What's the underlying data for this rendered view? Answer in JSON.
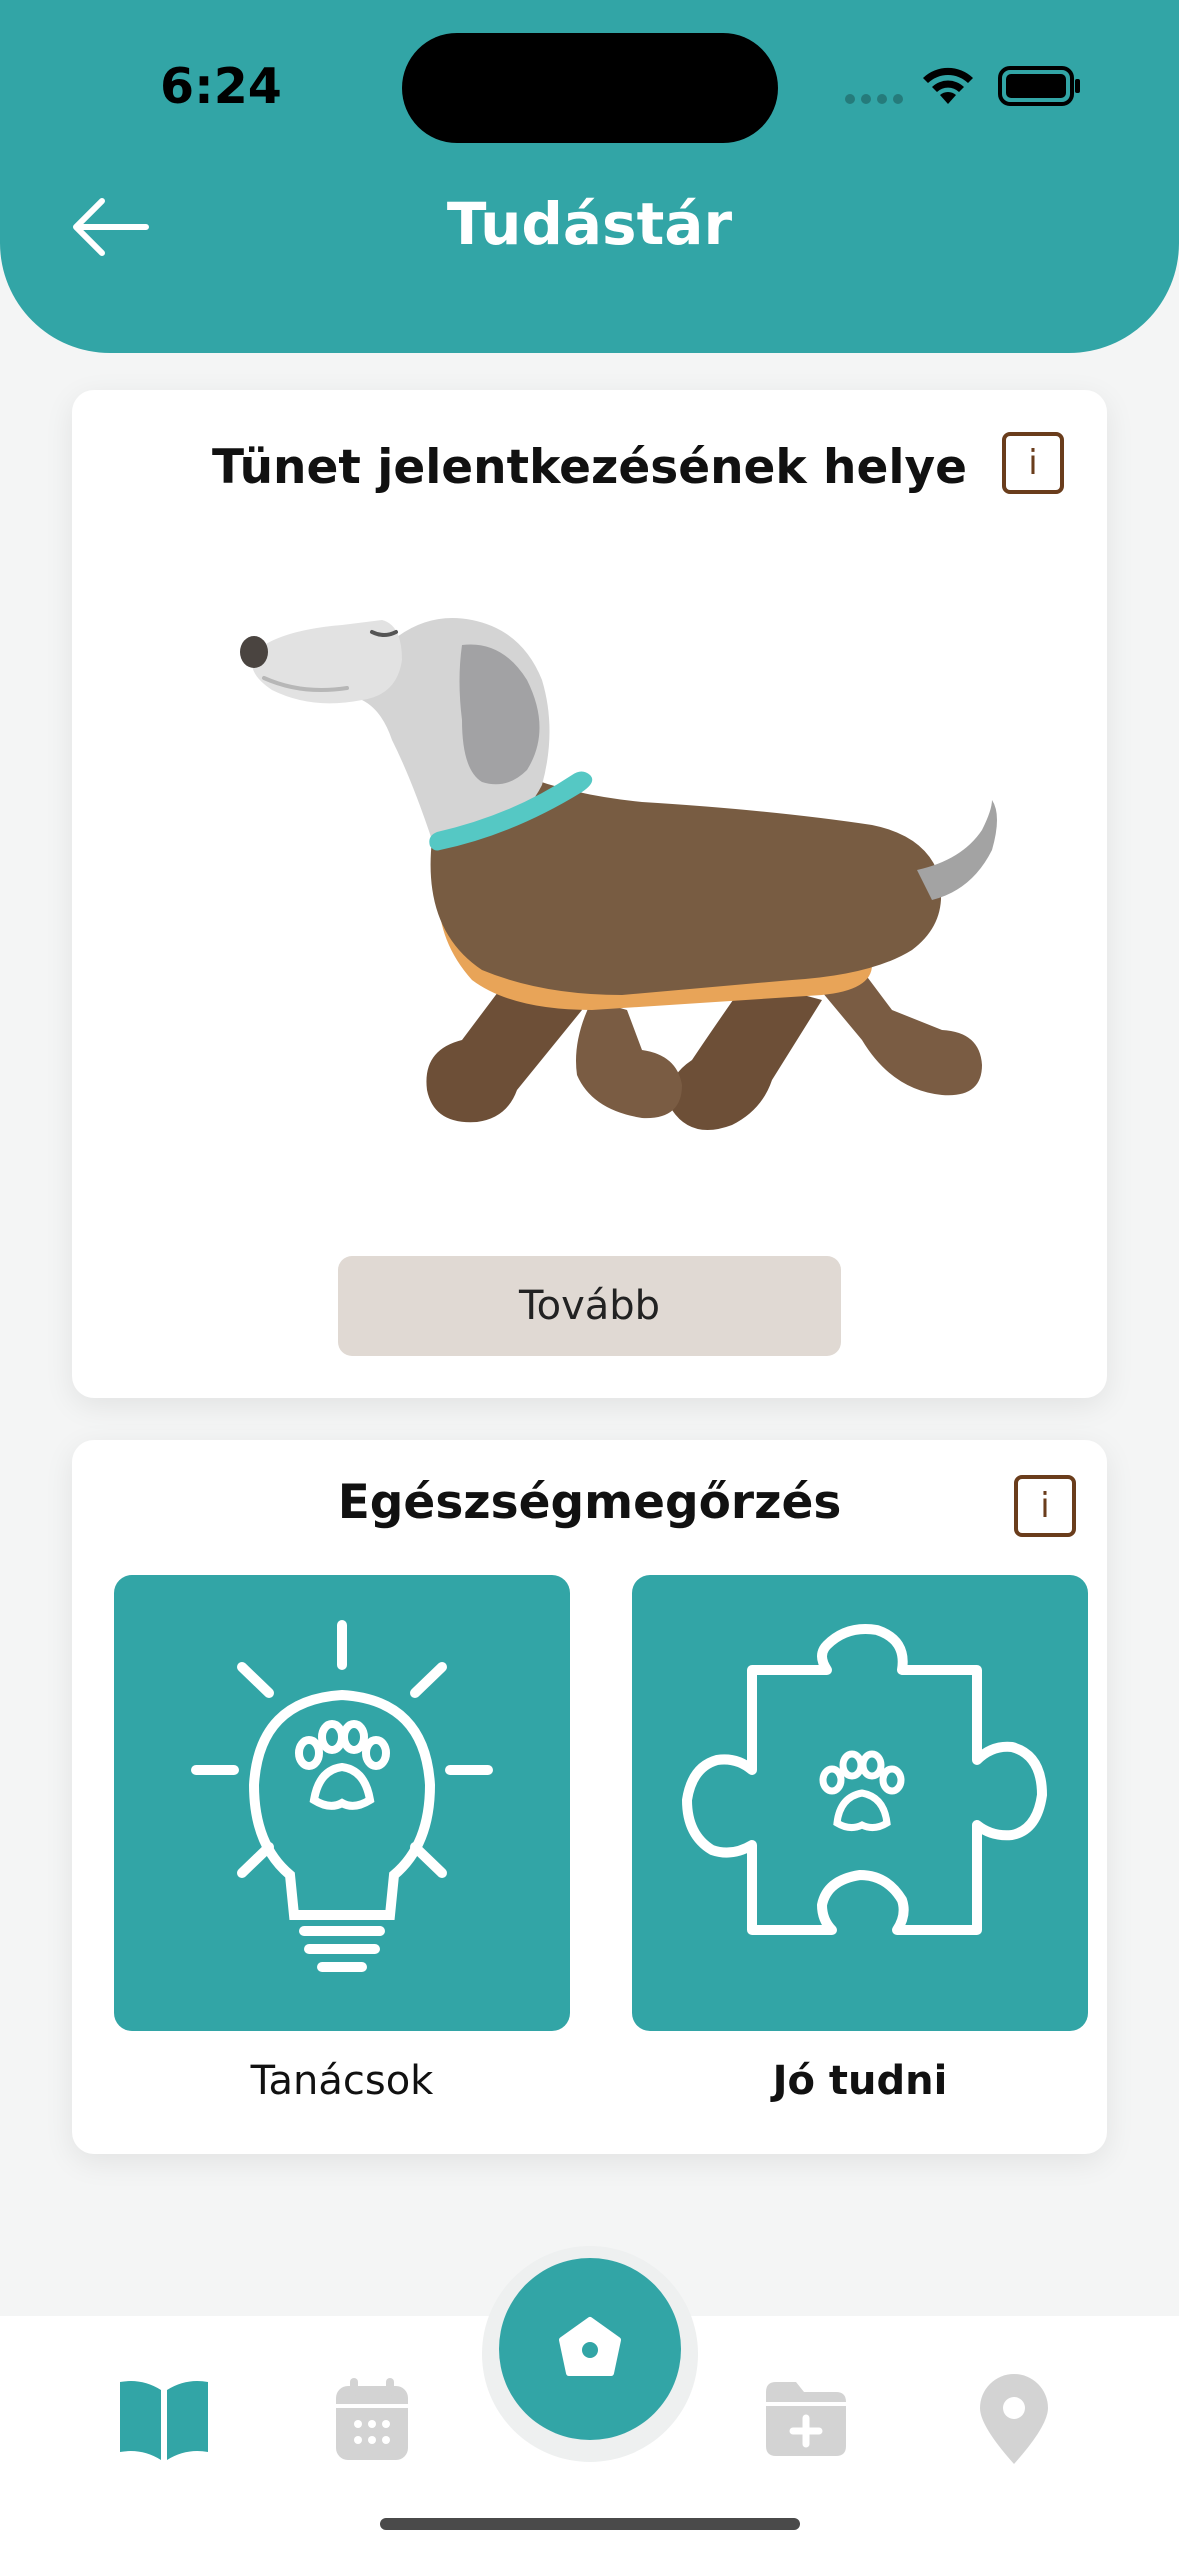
{
  "status_bar": {
    "time": "6:24"
  },
  "header": {
    "title": "Tudástár"
  },
  "symptom_card": {
    "title": "Tünet jelentkezésének helye",
    "info_label": "i",
    "next_label": "Tovább"
  },
  "health_card": {
    "title": "Egészségmegőrzés",
    "info_label": "i",
    "tiles": [
      {
        "label": "Tanácsok",
        "icon": "lightbulb-paw-icon"
      },
      {
        "label": "Jó tudni",
        "icon": "puzzle-paw-icon"
      }
    ]
  },
  "bottom_nav": {
    "items": [
      "book-icon",
      "calendar-icon",
      "home-icon",
      "folder-plus-icon",
      "location-pin-icon"
    ],
    "active": "book-icon"
  },
  "colors": {
    "primary": "#32a5a6",
    "info_brown": "#6a3d1c",
    "button_beige": "#e0d9d3",
    "inactive_icon": "#d3d3d3"
  }
}
